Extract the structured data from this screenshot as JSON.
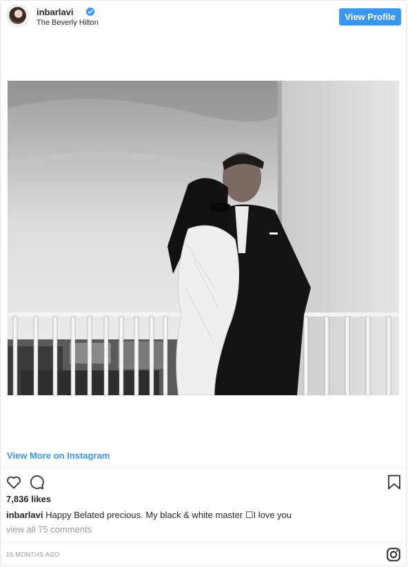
{
  "header": {
    "username": "inbarlavi",
    "location": "The Beverly Hilton",
    "view_profile_label": "View Profile"
  },
  "post": {
    "view_more_label": "View More on Instagram",
    "likes": "7,836 likes",
    "caption_user": "inbarlavi",
    "caption_text": "Happy Belated precious. My black & white master ☐I love you",
    "view_comments": "view all 75 comments",
    "timestamp": "15 MONTHS AGO"
  },
  "icons": {
    "verified": "verified-badge-icon",
    "like": "heart-icon",
    "comment": "comment-icon",
    "save": "bookmark-icon",
    "instagram": "instagram-logo-icon"
  },
  "colors": {
    "accent": "#3897f0",
    "text": "#262626",
    "muted": "#999999",
    "border": "#efefef"
  }
}
